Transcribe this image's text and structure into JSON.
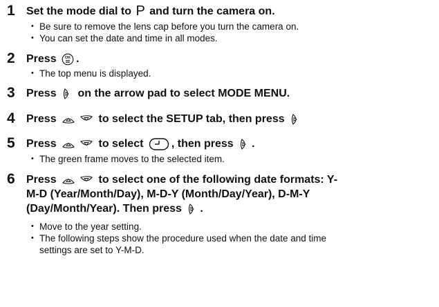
{
  "steps": [
    {
      "number": "1",
      "title_a": "Set the mode dial to",
      "mode_symbol": "P",
      "title_b": "and turn the camera on.",
      "bullets": [
        "Be sure to remove the lens cap before you turn the camera on.",
        "You can set the date and time in all modes."
      ]
    },
    {
      "number": "2",
      "title_a": "Press",
      "title_b": ".",
      "bullets": [
        "The top menu is displayed."
      ]
    },
    {
      "number": "3",
      "title_a": "Press",
      "title_b": "on the arrow pad to select MODE MENU."
    },
    {
      "number": "4",
      "title_a": "Press",
      "title_b": "to select the SETUP tab, then press"
    },
    {
      "number": "5",
      "title_a": "Press",
      "title_b": "to select",
      "title_c": ", then press",
      "title_d": ".",
      "bullets": [
        "The green frame moves to the selected item."
      ]
    },
    {
      "number": "6",
      "title_a": "Press",
      "title_line1": "to select one of the following date formats: Y-",
      "title_line2": "M-D (Year/Month/Day), M-D-Y (Month/Day/Year), D-M-Y",
      "title_line3": "(Day/Month/Year). Then press",
      "title_d": ".",
      "bullets": [
        "Move to the year setting.",
        "The following steps show the procedure used when the date and time",
        "settings are set to Y-M-D."
      ]
    }
  ],
  "icons": {
    "ok_button": "ok-menu-button-icon",
    "arrow_right": "arrow-right-icon",
    "arrow_up": "arrow-up-icon",
    "arrow_down": "arrow-down-icon",
    "clock": "clock-setting-icon"
  }
}
